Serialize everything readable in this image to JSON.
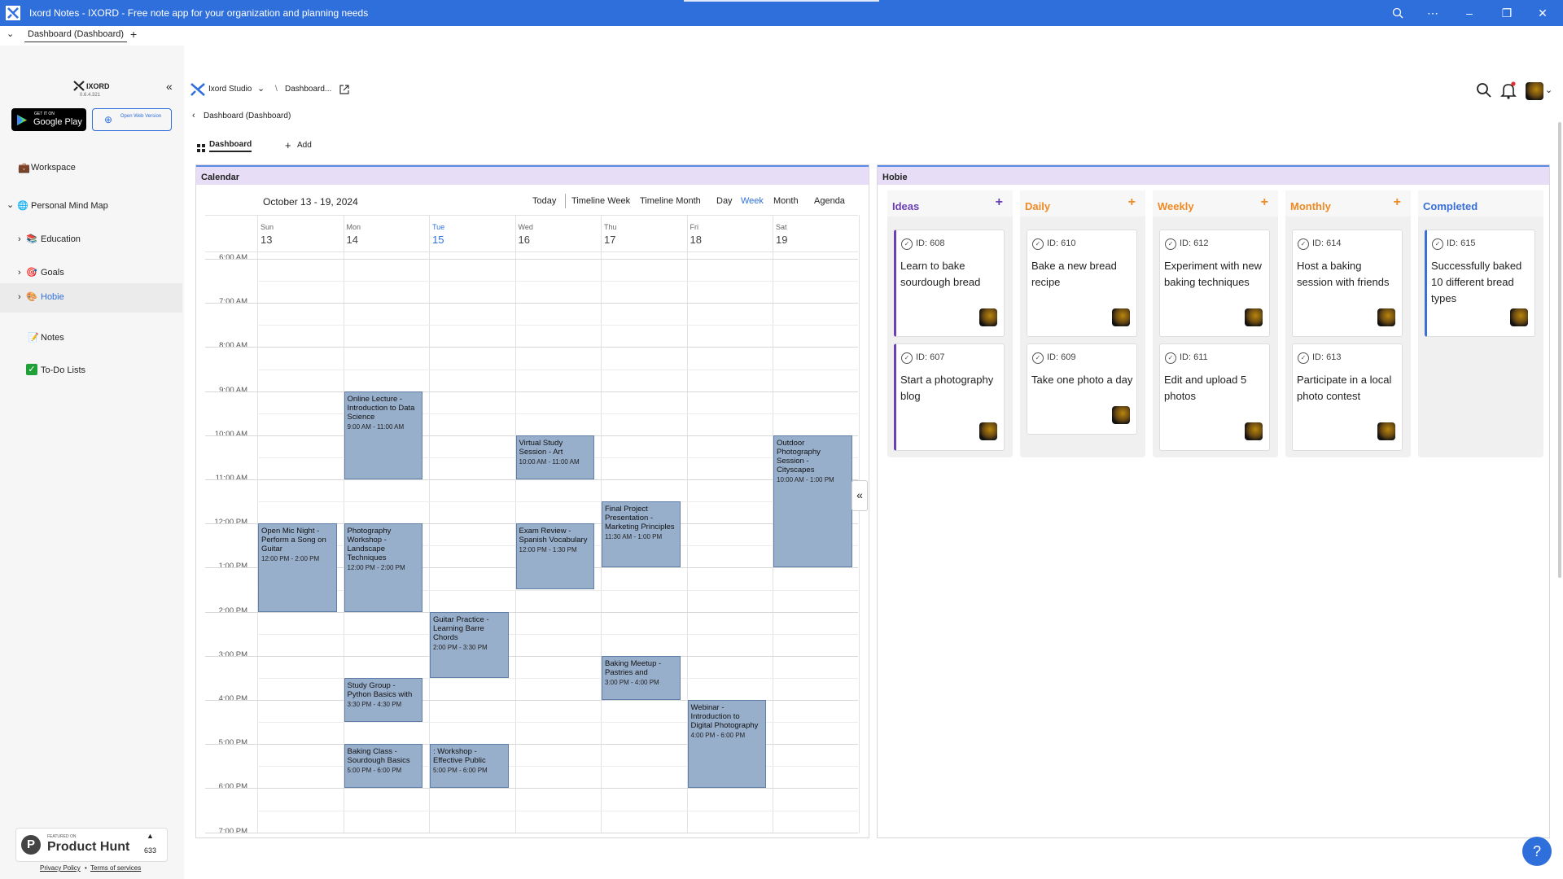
{
  "app": {
    "window_title": "Ixord Notes - IXORD - Free note app for your organization and planning needs",
    "tab_label": "Dashboard (Dashboard)",
    "tab_add": "+"
  },
  "sidebar": {
    "brand": "IXORD",
    "version": "0.6.4.321",
    "google_play_small": "GET IT ON",
    "google_play_big": "Google Play",
    "open_web": "Open Web Version",
    "workspace": "Workspace",
    "mind_map": "Personal Mind Map",
    "items": [
      {
        "label": "Education"
      },
      {
        "label": "Goals"
      },
      {
        "label": "Hobie"
      },
      {
        "label": "Notes"
      },
      {
        "label": "To-Do Lists"
      }
    ],
    "producthunt_small": "FEATURED ON",
    "producthunt_big": "Product Hunt",
    "producthunt_count": "633",
    "privacy": "Privacy Policy",
    "dot": "•",
    "terms": "Terms of services"
  },
  "topbar": {
    "studio": "Ixord Studio",
    "sep": "\\",
    "crumb": "Dashboard...",
    "back_crumb": "Dashboard (Dashboard)",
    "dash_tab": "Dashboard",
    "add": "Add"
  },
  "calendar": {
    "panel_title": "Calendar",
    "range": "October 13 - 19, 2024",
    "views": [
      "Today",
      "Timeline Week",
      "Timeline Month",
      "Day",
      "Week",
      "Month",
      "Agenda"
    ],
    "active_view": "Week",
    "days": [
      {
        "dow": "Sun",
        "num": "13"
      },
      {
        "dow": "Mon",
        "num": "14"
      },
      {
        "dow": "Tue",
        "num": "15"
      },
      {
        "dow": "Wed",
        "num": "16"
      },
      {
        "dow": "Thu",
        "num": "17"
      },
      {
        "dow": "Fri",
        "num": "18"
      },
      {
        "dow": "Sat",
        "num": "19"
      }
    ],
    "today_index": 2,
    "hours": [
      "6:00 AM",
      "7:00 AM",
      "8:00 AM",
      "9:00 AM",
      "10:00 AM",
      "11:00 AM",
      "12:00 PM",
      "1:00 PM",
      "2:00 PM",
      "3:00 PM",
      "4:00 PM",
      "5:00 PM",
      "6:00 PM",
      "7:00 PM"
    ],
    "events": [
      {
        "day": 1,
        "start": 9.0,
        "end": 11.0,
        "title": "Online Lecture - Introduction to Data Science",
        "time": "9:00 AM - 11:00 AM"
      },
      {
        "day": 3,
        "start": 10.0,
        "end": 11.0,
        "title": "Virtual Study Session - Art",
        "time": "10:00 AM - 11:00 AM"
      },
      {
        "day": 6,
        "start": 10.0,
        "end": 13.0,
        "title": "Outdoor Photography Session - Cityscapes",
        "time": "10:00 AM - 1:00 PM"
      },
      {
        "day": 4,
        "start": 11.5,
        "end": 13.0,
        "title": "Final Project Presentation - Marketing Principles",
        "time": "11:30 AM - 1:00 PM"
      },
      {
        "day": 0,
        "start": 12.0,
        "end": 14.0,
        "title": "Open Mic Night - Perform a Song on Guitar",
        "time": "12:00 PM - 2:00 PM"
      },
      {
        "day": 1,
        "start": 12.0,
        "end": 14.0,
        "title": "Photography Workshop - Landscape Techniques",
        "time": "12:00 PM - 2:00 PM"
      },
      {
        "day": 3,
        "start": 12.0,
        "end": 13.5,
        "title": "Exam Review - Spanish Vocabulary",
        "time": "12:00 PM - 1:30 PM"
      },
      {
        "day": 2,
        "start": 14.0,
        "end": 15.5,
        "title": "Guitar Practice - Learning Barre Chords",
        "time": "2:00 PM - 3:30 PM"
      },
      {
        "day": 4,
        "start": 15.0,
        "end": 16.0,
        "title": "Baking Meetup - Pastries and",
        "time": "3:00 PM - 4:00 PM"
      },
      {
        "day": 1,
        "start": 15.5,
        "end": 16.5,
        "title": "Study Group - Python Basics with",
        "time": "3:30 PM - 4:30 PM"
      },
      {
        "day": 5,
        "start": 16.0,
        "end": 18.0,
        "title": "Webinar - Introduction to Digital Photography",
        "time": "4:00 PM - 6:00 PM"
      },
      {
        "day": 1,
        "start": 17.0,
        "end": 18.0,
        "title": "Baking Class - Sourdough Basics",
        "time": "5:00 PM - 6:00 PM"
      },
      {
        "day": 2,
        "start": 17.0,
        "end": 18.0,
        "title": ": Workshop - Effective Public",
        "time": "5:00 PM - 6:00 PM"
      }
    ]
  },
  "kanban": {
    "panel_title": "Hobie",
    "columns": [
      {
        "title": "Ideas",
        "color": "#6b3fb5",
        "plus": "+",
        "plus_color": "#6b3fb5",
        "accent": "#6b3fb5",
        "cards": [
          {
            "id": "ID: 608",
            "text": "Learn to bake sourdough bread"
          },
          {
            "id": "ID: 607",
            "text": "Start a photography blog"
          }
        ]
      },
      {
        "title": "Daily",
        "color": "#f08a24",
        "plus": "+",
        "plus_color": "#f08a24",
        "accent": "",
        "cards": [
          {
            "id": "ID: 610",
            "text": "Bake a new bread recipe"
          },
          {
            "id": "ID: 609",
            "text": "Take one photo a day"
          }
        ]
      },
      {
        "title": "Weekly",
        "color": "#f08a24",
        "plus": "+",
        "plus_color": "#f08a24",
        "accent": "",
        "cards": [
          {
            "id": "ID: 612",
            "text": "Experiment with new baking techniques"
          },
          {
            "id": "ID: 611",
            "text": "Edit and upload 5 photos"
          }
        ]
      },
      {
        "title": "Monthly",
        "color": "#f08a24",
        "plus": "+",
        "plus_color": "#f08a24",
        "accent": "",
        "cards": [
          {
            "id": "ID: 614",
            "text": "Host a baking session with friends"
          },
          {
            "id": "ID: 613",
            "text": "Participate in a local photo contest"
          }
        ]
      },
      {
        "title": "Completed",
        "color": "#3a6fd6",
        "plus": "",
        "plus_color": "",
        "accent": "#3a6fd6",
        "cards": [
          {
            "id": "ID: 615",
            "text": "Successfully baked 10 different bread types"
          }
        ]
      }
    ]
  },
  "help": "?"
}
